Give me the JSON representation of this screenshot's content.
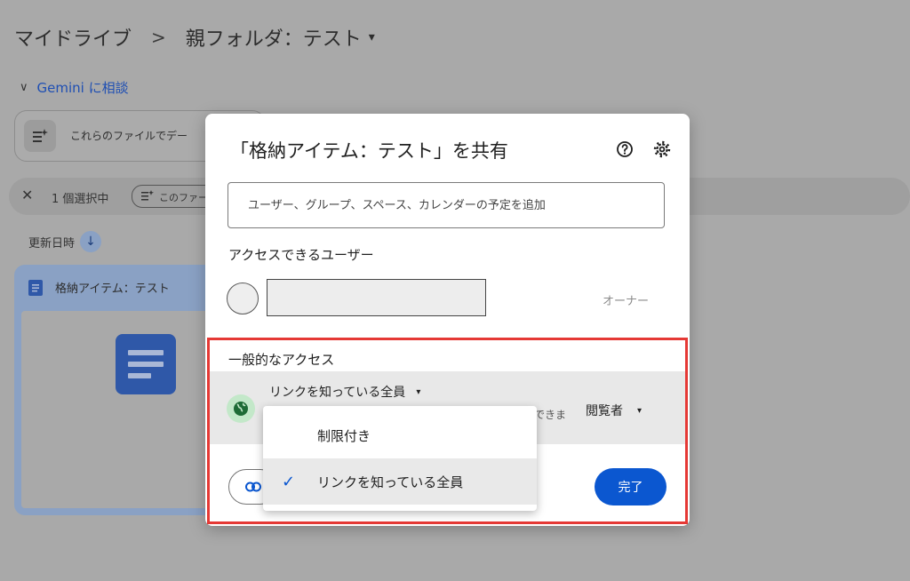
{
  "breadcrumb": {
    "root": "マイドライブ",
    "separator": ">",
    "current": "親フォルダ：テスト",
    "caret": "▾"
  },
  "gemini": {
    "chevron": "∨",
    "label": "Gemini に相談"
  },
  "prompt_card": {
    "text": "これらのファイルでデー"
  },
  "selection_bar": {
    "close": "✕",
    "count": "1 個選択中",
    "chip_label": "このファー"
  },
  "sort": {
    "label": "更新日時",
    "arrow": "↓"
  },
  "file_card": {
    "name": "格納アイテム：テスト"
  },
  "dialog": {
    "title": "「格納アイテム：テスト」を共有",
    "add_placeholder": "ユーザー、グループ、スペース、カレンダーの予定を追加",
    "access_heading": "アクセスできるユーザー",
    "owner_role": "オーナー",
    "general_heading": "一般的なアクセス",
    "link_setting": "リンクを知っている全員",
    "link_caret": "▾",
    "hint_tail": "できま",
    "role": "閲覧者",
    "role_caret": "▾",
    "done": "完了"
  },
  "menu": {
    "items": [
      {
        "label": "制限付き",
        "selected": false
      },
      {
        "label": "リンクを知っている全員",
        "selected": true
      }
    ],
    "check": "✓"
  },
  "colors": {
    "accent": "#0b57d0",
    "highlight_border": "#e53935",
    "globe_bg": "#c3e8c9"
  }
}
